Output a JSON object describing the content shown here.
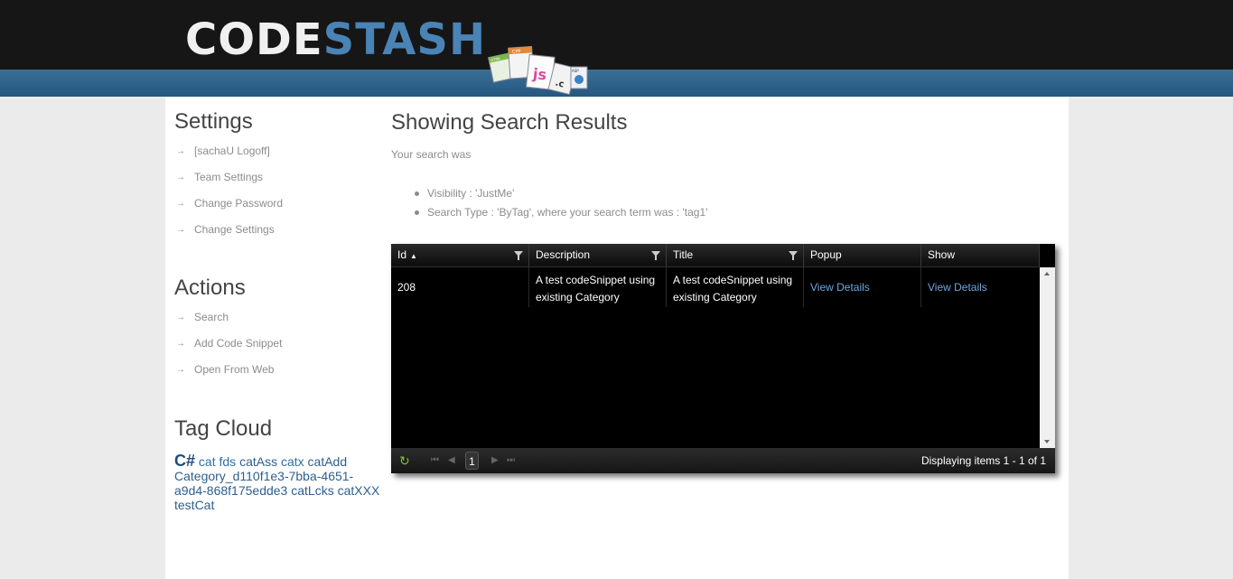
{
  "header": {
    "logo_code": "CODE",
    "logo_stash": "STASH",
    "logo_art_labels": [
      "HTML",
      "CPP",
      "js",
      ".c",
      "ASP"
    ]
  },
  "sidebar": {
    "settings_title": "Settings",
    "settings_items": [
      {
        "label": "[sachaU Logoff]"
      },
      {
        "label": "Team Settings"
      },
      {
        "label": "Change Password"
      },
      {
        "label": "Change Settings"
      }
    ],
    "actions_title": "Actions",
    "actions_items": [
      {
        "label": "Search"
      },
      {
        "label": "Add Code Snippet"
      },
      {
        "label": "Open From Web"
      }
    ],
    "tagcloud_title": "Tag Cloud",
    "tags": [
      "C#",
      "cat",
      "fds",
      "catAss",
      "catx",
      "catAdd",
      "Category_d110f1e3-7bba-4651-a9d4-868f175edde3",
      "catLcks",
      "catXXX",
      "testCat"
    ]
  },
  "main": {
    "title": "Showing Search Results",
    "subtitle": "Your search was",
    "criteria": [
      "Visibility : 'JustMe'",
      "Search Type : 'ByTag', where your search term was : 'tag1'"
    ]
  },
  "grid": {
    "columns": [
      "Id",
      "Description",
      "Title",
      "Popup",
      "Show"
    ],
    "rows": [
      {
        "id": "208",
        "description": "A test codeSnippet using existing Category",
        "title": "A test codeSnippet using existing Category",
        "popup": "View Details",
        "show": "View Details"
      }
    ],
    "pager": {
      "current_page": "1",
      "display_text": "Displaying items 1 - 1 of 1"
    }
  },
  "colors": {
    "accent_blue": "#2e6ea5",
    "link_blue": "#6fa7dc",
    "refresh_green": "#7bc62d"
  }
}
